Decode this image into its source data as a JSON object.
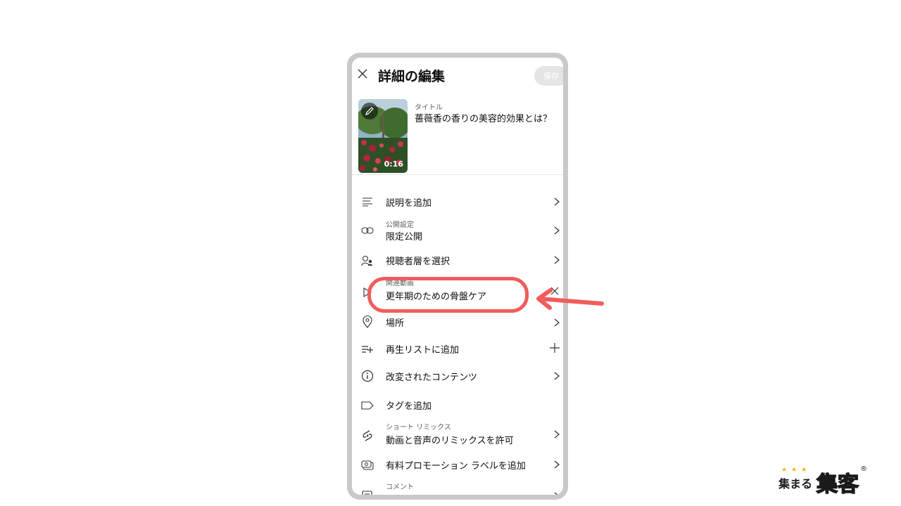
{
  "header": {
    "title": "詳細の編集",
    "save_label": "保存"
  },
  "video": {
    "title_label": "タイトル",
    "title_value": "薔薇香の香りの美容的効果とは？",
    "duration": "0:16"
  },
  "rows": {
    "description": {
      "label": "説明を追加"
    },
    "visibility": {
      "sublabel": "公開設定",
      "label": "限定公開"
    },
    "audience": {
      "label": "視聴者層を選択"
    },
    "related": {
      "sublabel": "関連動画",
      "label": "更年期のための骨盤ケア"
    },
    "location": {
      "label": "場所"
    },
    "playlist": {
      "label": "再生リストに追加"
    },
    "altered": {
      "label": "改変されたコンテンツ"
    },
    "tags": {
      "label": "タグを追加"
    },
    "remix": {
      "sublabel": "ショート リミックス",
      "label": "動画と音声のリミックスを許可"
    },
    "promotion": {
      "label": "有料プロモーション ラベルを追加"
    },
    "comments": {
      "sublabel": "コメント"
    }
  },
  "logo": {
    "small_text": "集まる",
    "big_text": "集客",
    "registered": "®",
    "stars": "★★★"
  },
  "colors": {
    "highlight": "#f25c5c",
    "frame": "#c9c9c9",
    "save_button_bg": "#e5e5e5"
  }
}
